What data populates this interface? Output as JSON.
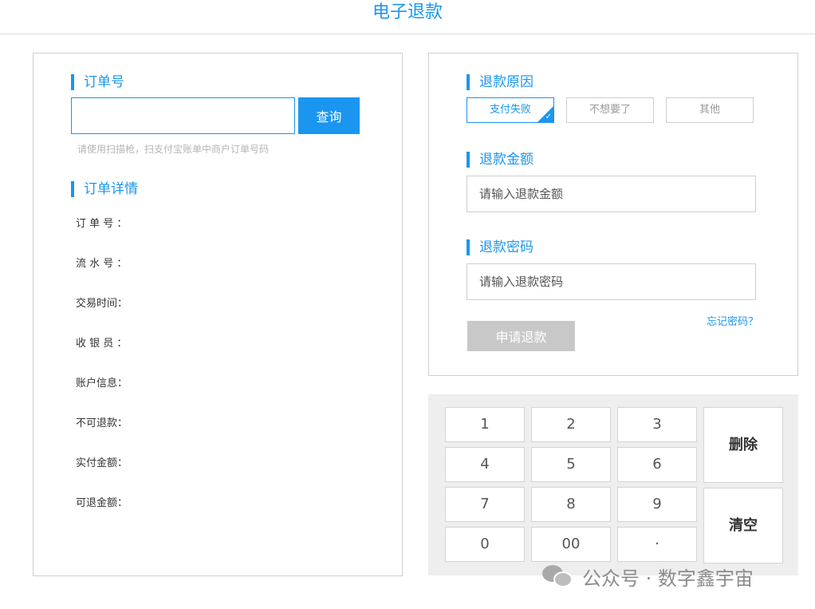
{
  "page": {
    "title": "电子退款"
  },
  "order_section": {
    "title": "订单号",
    "input_value": "",
    "query_label": "查询",
    "hint": "请使用扫描枪，扫支付宝账单中商户订单号码"
  },
  "detail_section": {
    "title": "订单详情",
    "labels": [
      "订 单 号 ：",
      "流 水 号 ：",
      "交易时间：",
      "收 银 员 ：",
      "账户信息：",
      "不可退款：",
      "实付金额：",
      "可退金额："
    ]
  },
  "reason_section": {
    "title": "退款原因",
    "options": [
      "支付失败",
      "不想要了",
      "其他"
    ],
    "selected_index": 0
  },
  "amount_section": {
    "title": "退款金额",
    "placeholder": "请输入退款金额"
  },
  "password_section": {
    "title": "退款密码",
    "placeholder": "请输入退款密码"
  },
  "forgot_label": "忘记密码？",
  "submit_label": "申请退款",
  "keypad": {
    "keys": [
      "1",
      "2",
      "3",
      "4",
      "5",
      "6",
      "7",
      "8",
      "9",
      "0",
      "00",
      "·"
    ],
    "delete_label": "删除",
    "clear_label": "清空"
  },
  "watermark": {
    "text": "公众号 · 数字鑫宇宙"
  },
  "colors": {
    "accent": "#1a96f0",
    "disabled": "#c8c8c8",
    "border": "#cfcfcf"
  },
  "icons": {
    "selected_check": "check-icon",
    "watermark": "wechat-icon"
  }
}
